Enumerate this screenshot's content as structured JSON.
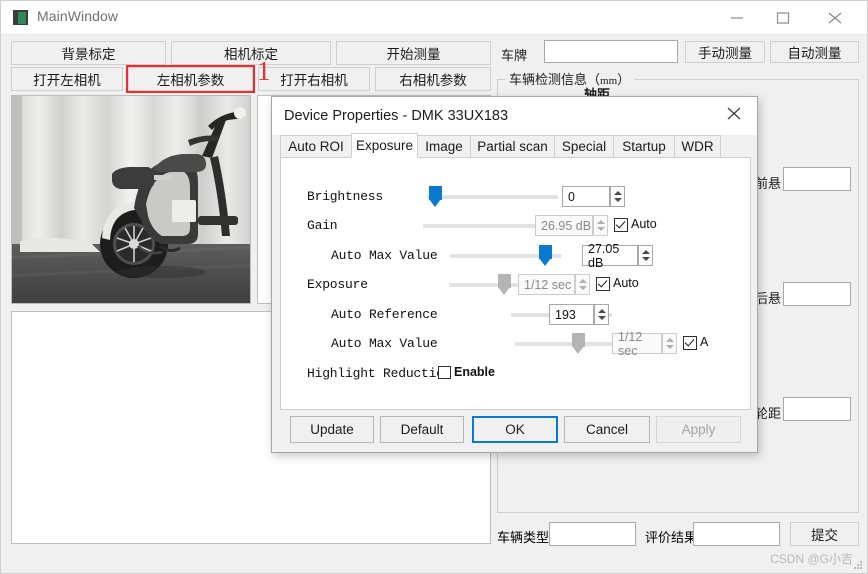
{
  "window": {
    "title": "MainWindow",
    "icon": "app-icon",
    "controls": {
      "minimize": "minimize-icon",
      "maximize": "maximize-icon",
      "close": "close-icon"
    }
  },
  "toolbar": {
    "row1": [
      {
        "id": "background-calibration",
        "label": "背景标定"
      },
      {
        "id": "camera-calibration",
        "label": "相机标定"
      },
      {
        "id": "start-measure",
        "label": "开始测量"
      }
    ],
    "row2": [
      {
        "id": "open-left-camera",
        "label": "打开左相机"
      },
      {
        "id": "left-camera-params",
        "label": "左相机参数"
      },
      {
        "id": "open-right-camera",
        "label": "打开右相机"
      },
      {
        "id": "right-camera-params",
        "label": "右相机参数"
      }
    ],
    "annotation": {
      "number": "1",
      "color": "#ef2b2b",
      "targets": "left-camera-params"
    }
  },
  "right_panel": {
    "plate_label": "车牌",
    "plate_value": "",
    "plate_placeholder": "",
    "manual_measure": "手动测量",
    "auto_measure": "自动测量",
    "group_title": "车辆检测信息（",
    "group_unit": "mm",
    "group_title_end": "）",
    "sub_title": "轴距",
    "fields": [
      {
        "id": "front-overhang",
        "label": "前悬",
        "value": ""
      },
      {
        "id": "rear-overhang",
        "label": "后悬",
        "value": ""
      },
      {
        "id": "track-width",
        "label": "轮距",
        "value": ""
      }
    ],
    "bottom": {
      "vehicle_type_label": "车辆类型",
      "vehicle_type_value": "",
      "result_label": "评价结果",
      "result_value": "",
      "submit_label": "提交"
    },
    "watermark": "CSDN @G小吉"
  },
  "dialog": {
    "title": "Device Properties - DMK 33UX183",
    "close_icon": "close-icon",
    "tabs": [
      {
        "label": "Auto ROI",
        "active": false
      },
      {
        "label": "Exposure",
        "active": true
      },
      {
        "label": "Image",
        "active": false
      },
      {
        "label": "Partial scan",
        "active": false
      },
      {
        "label": "Special",
        "active": false
      },
      {
        "label": "Startup",
        "active": false
      },
      {
        "label": "WDR",
        "active": false
      }
    ],
    "rows": [
      {
        "id": "brightness",
        "label": "Brightness",
        "indent": 0,
        "slider_pct": 2,
        "thumb": "blue",
        "value": "0",
        "disabled": false,
        "checkbox": null
      },
      {
        "id": "gain",
        "label": "Gain",
        "indent": 0,
        "slider_pct": 96,
        "thumb": "gray",
        "value": "26.95 dB",
        "disabled": true,
        "checkbox": {
          "label": "Auto",
          "checked": true
        }
      },
      {
        "id": "gain-auto-max-value",
        "label": "Auto Max Value",
        "indent": 1,
        "slider_pct": 91,
        "thumb": "blue",
        "value": "27.05 dB",
        "disabled": false,
        "checkbox": null
      },
      {
        "id": "exposure",
        "label": "Exposure",
        "indent": 0,
        "slider_pct": 49,
        "thumb": "gray",
        "value": "1/12 sec",
        "disabled": true,
        "checkbox": {
          "label": "Auto",
          "checked": true
        }
      },
      {
        "id": "auto-reference",
        "label": "Auto Reference",
        "indent": 1,
        "slider_pct": 72,
        "thumb": "blue",
        "value": "193",
        "disabled": false,
        "checkbox": null
      },
      {
        "id": "exposure-auto-max-value",
        "label": "Auto Max Value",
        "indent": 1,
        "slider_pct": 68,
        "thumb": "gray",
        "value": "1/12 sec",
        "disabled": true,
        "checkbox": {
          "label": "A",
          "checked": true
        }
      }
    ],
    "highlight_reduction": {
      "label": "Highlight Reduction",
      "checkbox_label": "Enable",
      "checked": false
    },
    "buttons": [
      {
        "id": "update",
        "label": "Update",
        "style": "normal"
      },
      {
        "id": "default",
        "label": "Default",
        "style": "normal"
      },
      {
        "id": "ok",
        "label": "OK",
        "style": "default"
      },
      {
        "id": "cancel",
        "label": "Cancel",
        "style": "normal"
      },
      {
        "id": "apply",
        "label": "Apply",
        "style": "disabled"
      }
    ]
  },
  "colors": {
    "accent": "#0a7ad1",
    "highlight": "#ef2b2b",
    "chrome": "#f0f0f0"
  }
}
